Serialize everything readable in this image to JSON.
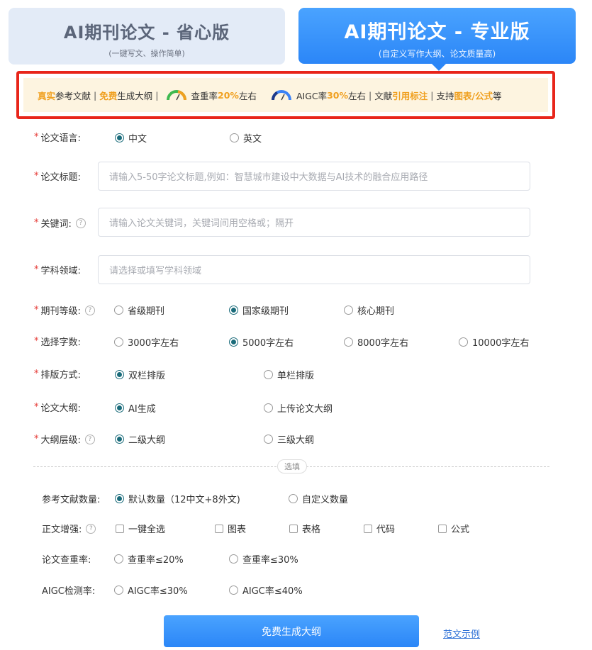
{
  "tabs": {
    "basic": {
      "title": "AI期刊论文 - 省心版",
      "subtitle": "(一键写文、操作简单)"
    },
    "pro": {
      "title": "AI期刊论文 - 专业版",
      "subtitle": "(自定义写作大纲、论文质量高)"
    }
  },
  "banner": {
    "p1_hl": "真实",
    "p1": "参考文献",
    "sep": "|",
    "p2_hl": "免费",
    "p2": "生成大纲",
    "p3_pre": "查重率",
    "p3_hl": "20%",
    "p3_post": "左右",
    "p4_pre": "AIGC率",
    "p4_hl": "30%",
    "p4_post": " 左右",
    "p5_pre": "文献",
    "p5_hl": "引用标注",
    "p6_pre": "支持",
    "p6_hl": "图表/公式",
    "p6_post": "等",
    "colors": {
      "accent": "#f0a020",
      "border": "#e8251a",
      "gauge_green": "#3fb950",
      "gauge_blue": "#3b82f6"
    }
  },
  "form": {
    "language": {
      "label": "论文语言:",
      "options": [
        "中文",
        "英文"
      ],
      "selected": "中文"
    },
    "title": {
      "label": "论文标题:",
      "placeholder": "请输入5-50字论文标题,例如：智慧城市建设中大数据与AI技术的融合应用路径"
    },
    "keywords": {
      "label": "关键词:",
      "placeholder": "请输入论文关键词，关键词间用空格或；隔开",
      "help": "?"
    },
    "field": {
      "label": "学科领域:",
      "placeholder": "请选择或填写学科领域"
    },
    "journal_level": {
      "label": "期刊等级:",
      "options": [
        "省级期刊",
        "国家级期刊",
        "核心期刊"
      ],
      "selected": "国家级期刊",
      "help": "?"
    },
    "word_count": {
      "label": "选择字数:",
      "options": [
        "3000字左右",
        "5000字左右",
        "8000字左右",
        "10000字左右"
      ],
      "selected": "5000字左右"
    },
    "layout": {
      "label": "排版方式:",
      "options": [
        "双栏排版",
        "单栏排版"
      ],
      "selected": "双栏排版"
    },
    "outline": {
      "label": "论文大纲:",
      "options": [
        "AI生成",
        "上传论文大纲"
      ],
      "selected": "AI生成"
    },
    "outline_level": {
      "label": "大纲层级:",
      "options": [
        "二级大纲",
        "三级大纲"
      ],
      "selected": "二级大纲",
      "help": "?"
    }
  },
  "optional": {
    "divider_label": "选填",
    "references": {
      "label": "参考文献数量:",
      "options": [
        "默认数量（12中文+8外文)",
        "自定义数量"
      ],
      "selected": "默认数量（12中文+8外文)"
    },
    "enhance": {
      "label": "正文增强:",
      "help": "?",
      "options": [
        "一键全选",
        "图表",
        "表格",
        "代码",
        "公式"
      ]
    },
    "plagiarism": {
      "label": "论文查重率:",
      "options": [
        "查重率≤20%",
        "查重率≤30%"
      ]
    },
    "aigc": {
      "label": "AIGC检测率:",
      "options": [
        "AIGC率≤30%",
        "AIGC率≤40%"
      ]
    }
  },
  "actions": {
    "submit": "免费生成大纲",
    "sample": "范文示例"
  }
}
